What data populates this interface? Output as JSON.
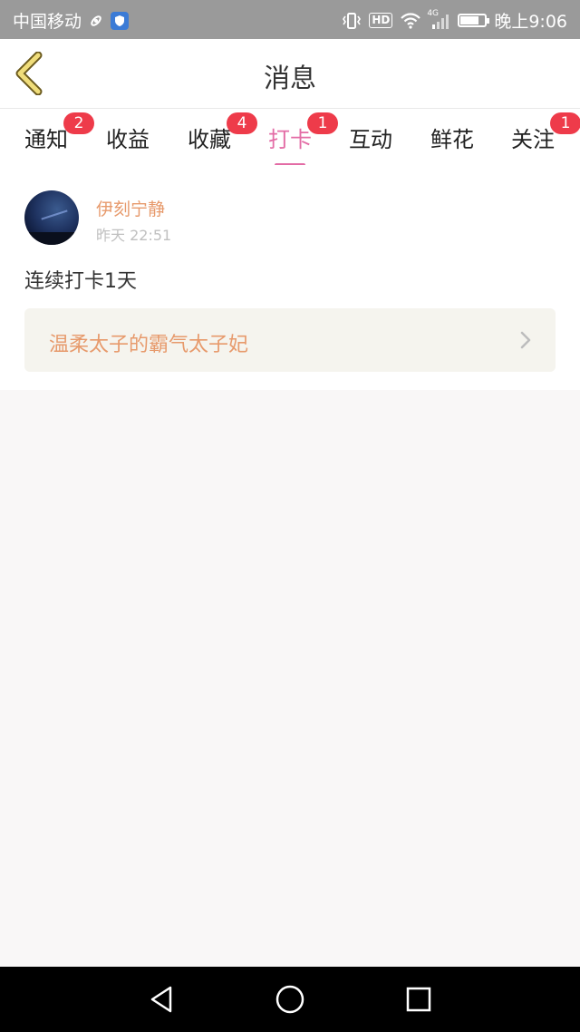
{
  "status_bar": {
    "carrier": "中国移动",
    "hd_label": "HD",
    "network": "4G",
    "time": "晚上9:06",
    "battery_level": 0.72
  },
  "header": {
    "title": "消息",
    "back_icon": "chevron-left-icon"
  },
  "tabs": [
    {
      "label": "通知",
      "badge": "2"
    },
    {
      "label": "收益",
      "badge": ""
    },
    {
      "label": "收藏",
      "badge": "4"
    },
    {
      "label": "打卡",
      "badge": "1",
      "active": true
    },
    {
      "label": "互动",
      "badge": ""
    },
    {
      "label": "鲜花",
      "badge": ""
    },
    {
      "label": "关注",
      "badge": "1"
    }
  ],
  "colors": {
    "accent": "#e36ca5",
    "badge": "#ee3b4a",
    "username": "#e79a6c"
  },
  "feed": {
    "item": {
      "username": "伊刻宁静",
      "time": "昨天 22:51",
      "message": "连续打卡1天",
      "book_title": "温柔太子的霸气太子妃"
    }
  },
  "system_nav": {
    "back_icon": "triangle-back-icon",
    "home_icon": "circle-home-icon",
    "recents_icon": "square-recents-icon"
  }
}
